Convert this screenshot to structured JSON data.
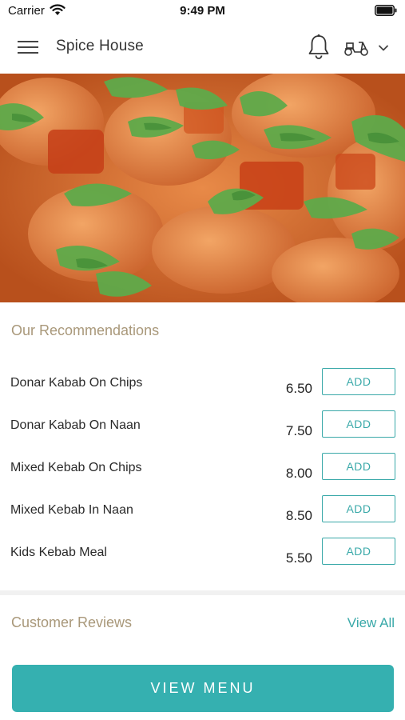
{
  "status_bar": {
    "carrier": "Carrier",
    "time": "9:49 PM"
  },
  "nav": {
    "title": "Spice House",
    "icons": [
      "menu-icon",
      "bell-icon",
      "scooter-icon",
      "chevron-down-icon"
    ]
  },
  "hero": {
    "description_icon": "food-photo"
  },
  "recommendations": {
    "title": "Our Recommendations",
    "add_label": "ADD",
    "items": [
      {
        "name": "Donar Kabab On Chips",
        "price": "6.50"
      },
      {
        "name": "Donar Kabab On Naan",
        "price": "7.50"
      },
      {
        "name": "Mixed Kebab On Chips",
        "price": "8.00"
      },
      {
        "name": "Mixed Kebab In Naan",
        "price": "8.50"
      },
      {
        "name": "Kids Kebab Meal",
        "price": "5.50"
      }
    ]
  },
  "reviews": {
    "title": "Customer Reviews",
    "view_all": "View All"
  },
  "footer": {
    "view_menu": "VIEW MENU"
  },
  "colors": {
    "accent": "#35b0b0",
    "section_title": "#a9987a"
  }
}
